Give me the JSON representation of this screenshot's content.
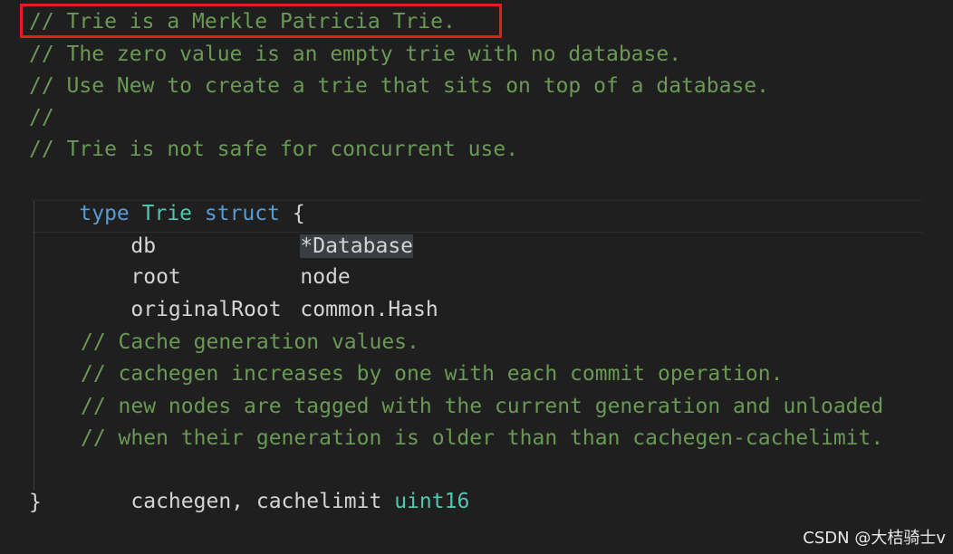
{
  "editor": {
    "comment_lines": [
      "// Trie is a Merkle Patricia Trie.",
      "// The zero value is an empty trie with no database.",
      "// Use New to create a trie that sits on top of a database.",
      "//",
      "// Trie is not safe for concurrent use."
    ],
    "struct_decl": {
      "keyword_type": "type",
      "name": "Trie",
      "keyword_struct": "struct",
      "open_brace": "{",
      "close_brace": "}"
    },
    "fields": [
      {
        "name": "db",
        "type": "*Database"
      },
      {
        "name": "root",
        "type": "node"
      },
      {
        "name": "originalRoot",
        "type": "common.Hash"
      }
    ],
    "inner_comments": [
      "// Cache generation values.",
      "// cachegen increases by one with each commit operation.",
      "// new nodes are tagged with the current generation and unloaded",
      "// when their generation is older than than cachegen-cachelimit."
    ],
    "last_field": {
      "names": "cachegen, cachelimit",
      "type": "uint16"
    }
  },
  "watermark": "CSDN @大桔骑士v",
  "colors": {
    "background": "#1f1f1f",
    "comment": "#6a9955",
    "keyword": "#569cd6",
    "type": "#4ec9b0",
    "highlight_box": "#e81c1c"
  }
}
